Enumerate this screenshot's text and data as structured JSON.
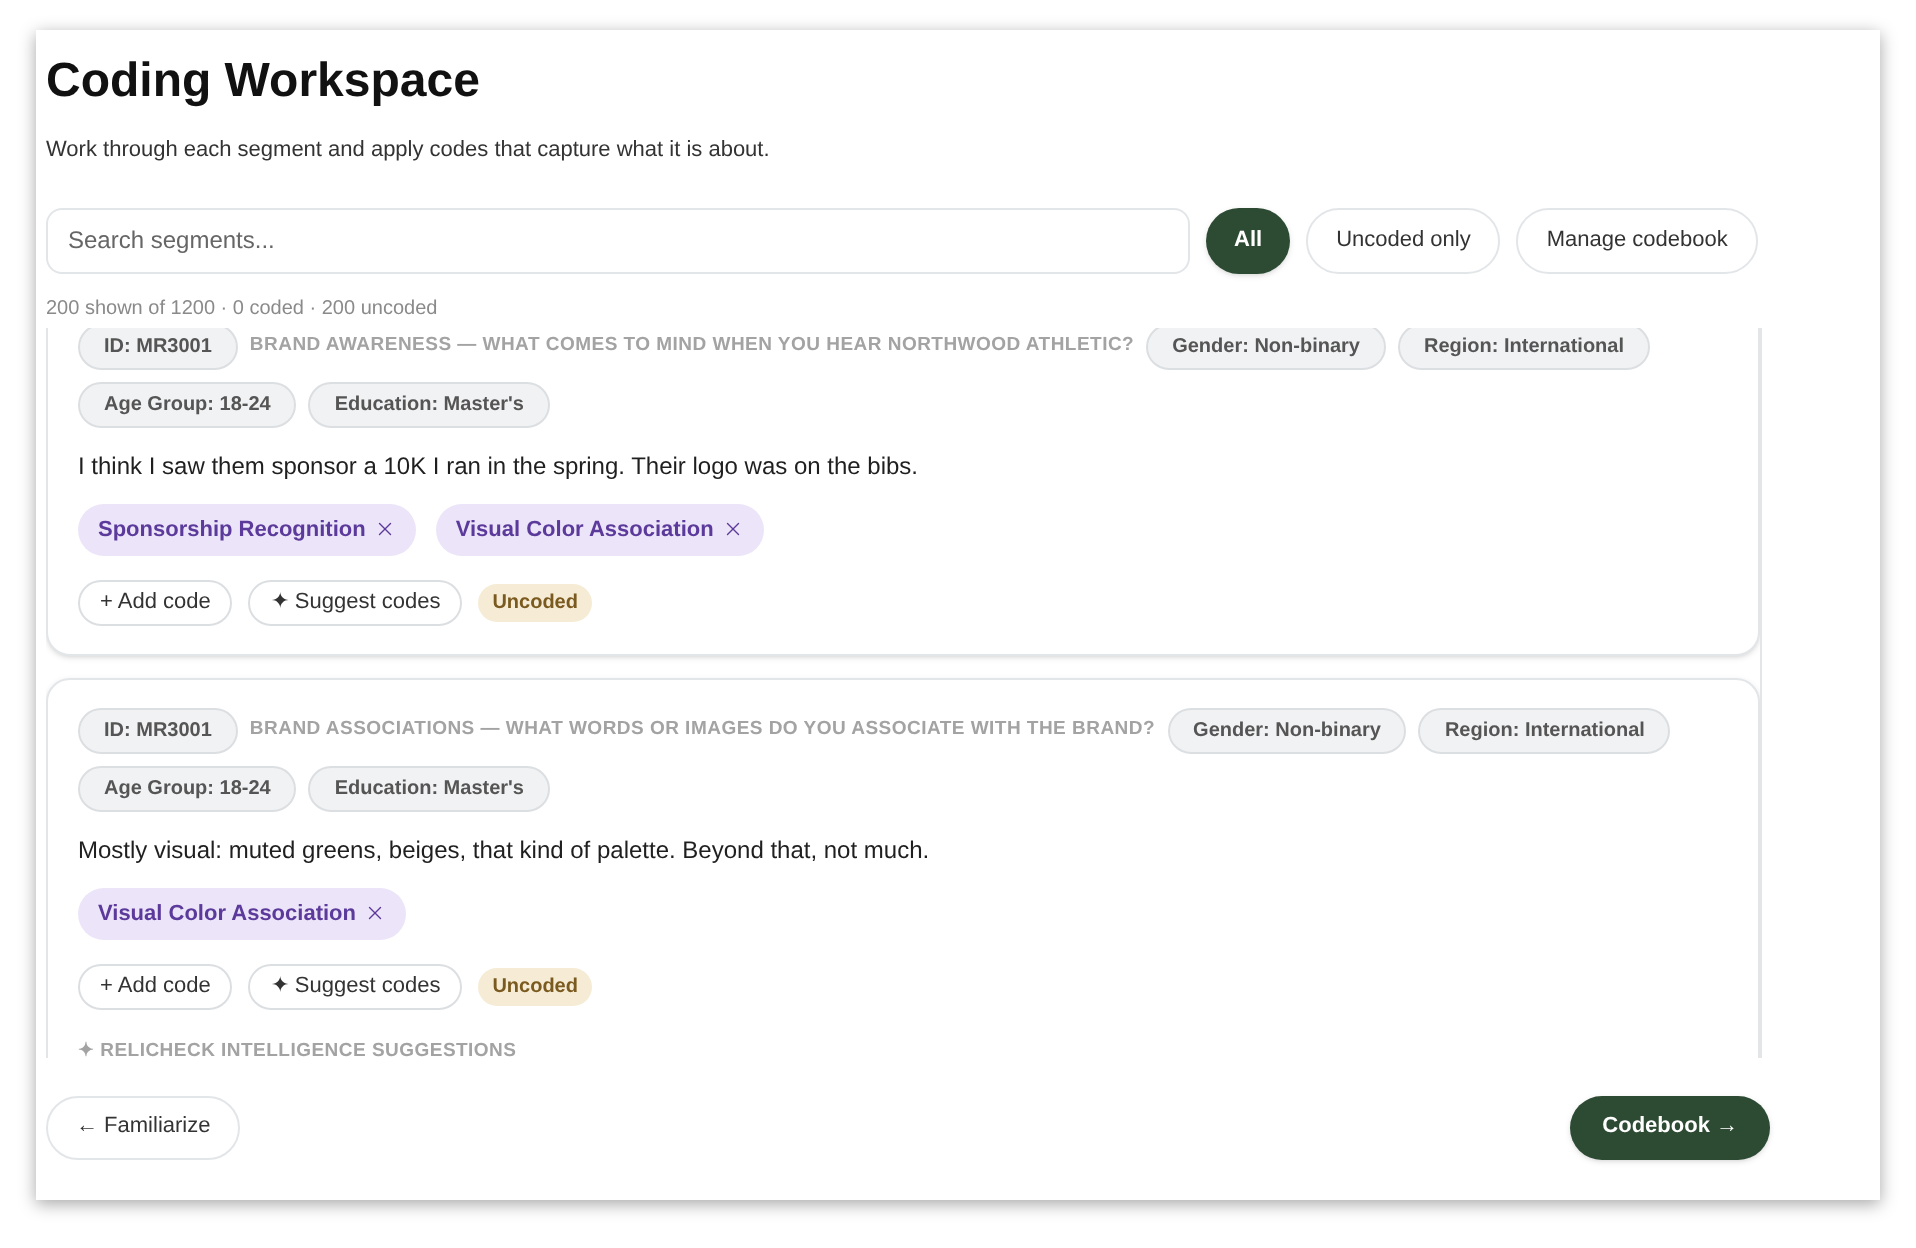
{
  "header": {
    "title": "Coding Workspace",
    "subtitle": "Work through each segment and apply codes that capture what it is about."
  },
  "search": {
    "placeholder": "Search segments..."
  },
  "filters": [
    {
      "label": "All",
      "selected": true
    },
    {
      "label": "Uncoded only",
      "selected": false
    }
  ],
  "manage_button": "Manage codebook",
  "summary": "200 shown of 1200 · 0 coded · 200 uncoded",
  "segments": [
    {
      "id": "ID: MR3001",
      "question": "BRAND AWARENESS — WHAT COMES TO MIND WHEN YOU HEAR NORTHWOOD ATHLETIC?",
      "attributes": [
        "Gender: Non-binary",
        "Region: International",
        "Age Group: 18-24",
        "Education: Master's"
      ],
      "text": "I think I saw them sponsor a 10K I ran in the spring. Their logo was on the bibs.",
      "codes": [
        "Sponsorship Recognition",
        "Visual Color Association"
      ],
      "add_label": "+ Add code",
      "suggest_label": "✦ Suggest codes",
      "status": "Uncoded"
    },
    {
      "id": "ID: MR3001",
      "question": "BRAND ASSOCIATIONS — WHAT WORDS OR IMAGES DO YOU ASSOCIATE WITH THE BRAND?",
      "attributes": [
        "Gender: Non-binary",
        "Region: International",
        "Age Group: 18-24",
        "Education: Master's"
      ],
      "text": "Mostly visual: muted greens, beiges, that kind of palette. Beyond that, not much.",
      "codes": [
        "Visual Color Association"
      ],
      "add_label": "+ Add code",
      "suggest_label": "✦ Suggest codes",
      "status": "Uncoded",
      "suggestions_label": "✦ RELICHECK INTELLIGENCE SUGGESTIONS"
    }
  ],
  "footer": {
    "back": "← Familiarize",
    "next": "Codebook →"
  }
}
